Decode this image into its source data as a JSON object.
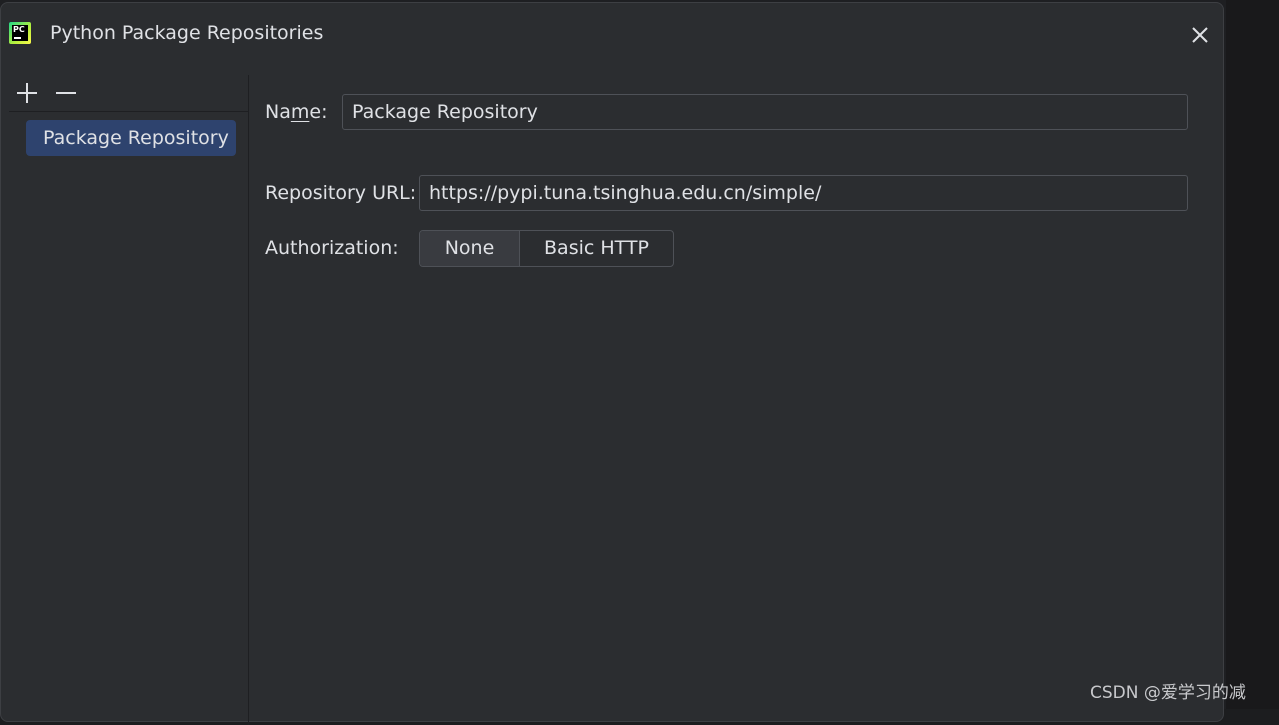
{
  "window": {
    "title": "Python Package Repositories"
  },
  "sidebar": {
    "add_icon": "plus-icon",
    "remove_icon": "minus-icon",
    "items": [
      {
        "label": "Package Repository",
        "selected": true
      }
    ]
  },
  "form": {
    "name_label_pre": "Na",
    "name_label_mnemonic": "m",
    "name_label_post": "e:",
    "name_value": "Package Repository",
    "url_label": "Repository URL:",
    "url_value": "https://pypi.tuna.tsinghua.edu.cn/simple/",
    "auth_label": "Authorization:",
    "auth_options": [
      "None",
      "Basic HTTP"
    ],
    "auth_selected": "None"
  },
  "watermark": "CSDN @爱学习的减",
  "colors": {
    "dialog_bg": "#2b2d30",
    "selection": "#2e436e",
    "text": "#dfe1e5",
    "border": "#4e5157"
  }
}
